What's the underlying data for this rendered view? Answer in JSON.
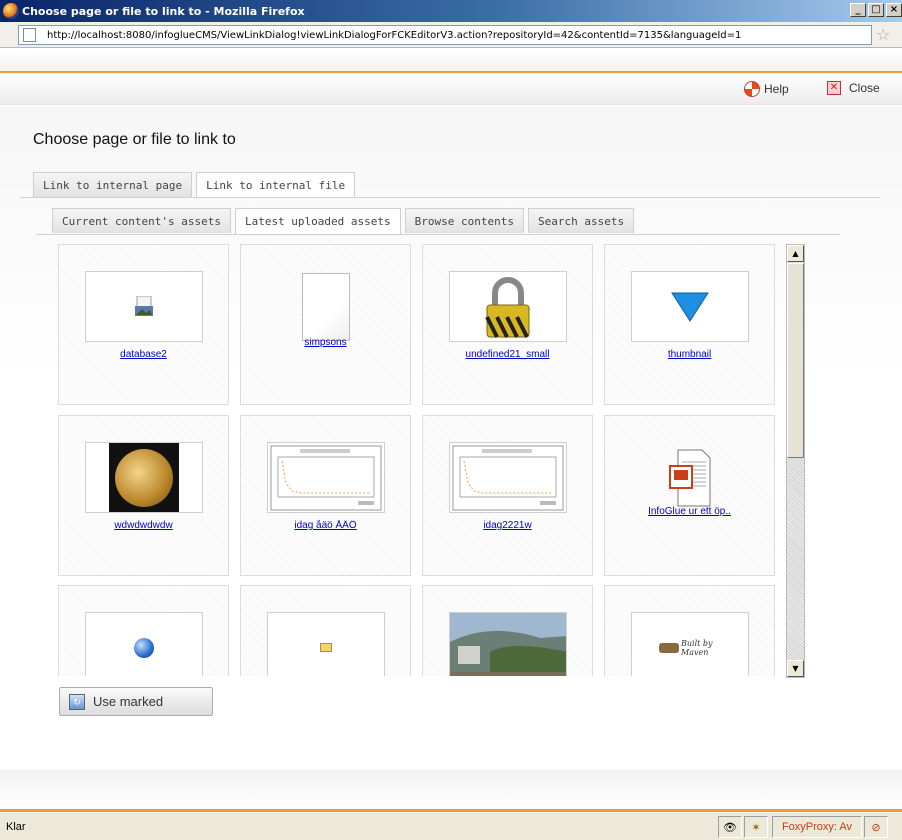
{
  "window": {
    "title": "Choose page or file to link to - Mozilla Firefox",
    "url": "http://localhost:8080/infoglueCMS/ViewLinkDialog!viewLinkDialogForFCKEditorV3.action?repositoryId=42&contentId=7135&languageId=1"
  },
  "toolbar": {
    "help_label": "Help",
    "close_label": "Close"
  },
  "page": {
    "heading": "Choose page or file to link to"
  },
  "tabs": [
    {
      "label": "Link to internal page",
      "active": false
    },
    {
      "label": "Link to internal file",
      "active": true
    }
  ],
  "subtabs": [
    {
      "label": "Current content's assets",
      "active": false
    },
    {
      "label": "Latest uploaded assets",
      "active": true
    },
    {
      "label": "Browse contents",
      "active": false
    },
    {
      "label": "Search assets",
      "active": false
    }
  ],
  "assets": [
    {
      "name": "database2",
      "icon": "image-file-icon"
    },
    {
      "name": "simpsons",
      "icon": "blank-page-icon"
    },
    {
      "name": "undefined21_small",
      "icon": "padlock-icon"
    },
    {
      "name": "thumbnail",
      "icon": "blue-triangle-icon"
    },
    {
      "name": "wdwdwdwdw",
      "icon": "gold-medal-icon"
    },
    {
      "name": "idag åäö ÅÄÖ",
      "icon": "chart-screenshot-icon"
    },
    {
      "name": "idag2221w",
      "icon": "chart-screenshot-icon"
    },
    {
      "name": "InfoGlue ur ett öp..",
      "icon": "powerpoint-doc-icon"
    },
    {
      "name": "",
      "icon": "globe-icon"
    },
    {
      "name": "",
      "icon": "folder-icon"
    },
    {
      "name": "",
      "icon": "landscape-photo-icon"
    },
    {
      "name": "",
      "icon": "built-by-maven-icon"
    }
  ],
  "maven_text": "Built by Maven",
  "use_marked_label": "Use marked",
  "status": {
    "text": "Klar",
    "foxyproxy": "FoxyProxy: Av"
  },
  "colors": {
    "accent_orange": "#f09a3a",
    "link_blue": "#0000cc"
  }
}
